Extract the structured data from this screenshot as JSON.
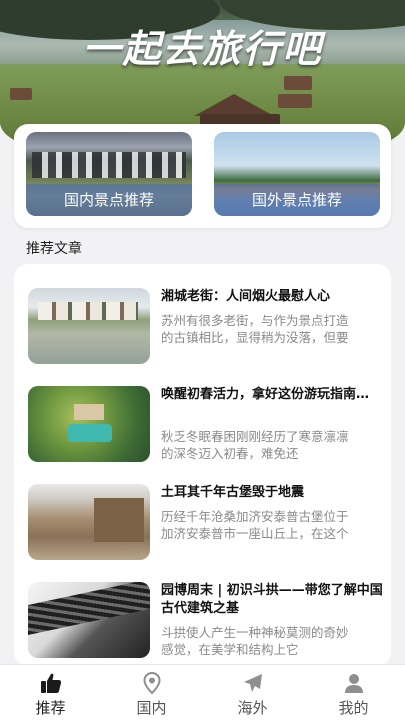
{
  "hero": {
    "title": "一起去旅行吧"
  },
  "categories": [
    {
      "label": "国内景点推荐"
    },
    {
      "label": "国外景点推荐"
    }
  ],
  "section": {
    "title": "推荐文章"
  },
  "articles": [
    {
      "title": "湘城老街：人间烟火最慰人心",
      "excerpt": "苏州有很多老街，与作为景点打造的古镇相比，显得稍为没落，但要搬出一两个与老街…"
    },
    {
      "title": "唤醒初春活力，拿好这份游玩指南…",
      "excerpt": "秋乏冬眠春困刚刚经历了寒意凛凛的深冬迈入初春，难免还"
    },
    {
      "title": "土耳其千年古堡毁于地震",
      "excerpt": "历经千年沧桑加济安泰普古堡位于加济安泰普市一座山丘上，在这个城市到处都能看"
    },
    {
      "title": "园博周末 | 初识斗拱——带您了解中国古代建筑之基",
      "excerpt": "斗拱使人产生一种神秘莫测的奇妙感觉，在美学和结构上它"
    }
  ],
  "tabbar": {
    "tabs": [
      {
        "label": "推荐",
        "icon": "thumbs-up-icon",
        "active": true
      },
      {
        "label": "国内",
        "icon": "location-pin-icon",
        "active": false
      },
      {
        "label": "海外",
        "icon": "airplane-icon",
        "active": false
      },
      {
        "label": "我的",
        "icon": "user-icon",
        "active": false
      }
    ]
  },
  "colors": {
    "background": "#f2f2f4",
    "category_label_bg": "#506eaa",
    "muted_text": "#8a8a8a",
    "icon_gray": "#8f8f8f"
  }
}
